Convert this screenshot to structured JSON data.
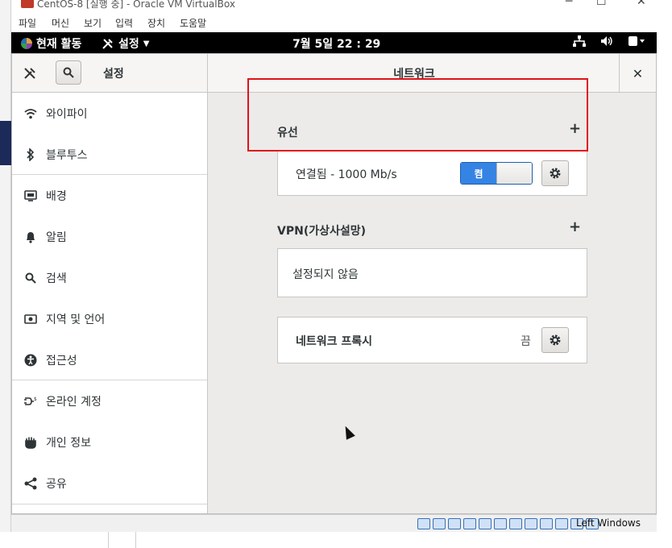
{
  "vbox": {
    "title": "CentOS-8 [실행 중] - Oracle VM VirtualBox",
    "menu": [
      "파일",
      "머신",
      "보기",
      "입력",
      "장치",
      "도움말"
    ],
    "host_key": "Left Windows"
  },
  "gnome": {
    "activities": "현재 활동",
    "app_menu": "설정",
    "clock": "7월 5일  22 : 29"
  },
  "settings": {
    "header_title": "설정",
    "panel_title": "네트워크",
    "sidebar": [
      {
        "label": "와이파이",
        "icon": "wifi-icon"
      },
      {
        "label": "블루투스",
        "icon": "bluetooth-icon"
      },
      {
        "label": "배경",
        "icon": "background-icon"
      },
      {
        "label": "알림",
        "icon": "bell-icon"
      },
      {
        "label": "검색",
        "icon": "search-icon"
      },
      {
        "label": "지역 및 언어",
        "icon": "region-icon"
      },
      {
        "label": "접근성",
        "icon": "accessibility-icon"
      },
      {
        "label": "온라인 계정",
        "icon": "online-accounts-icon"
      },
      {
        "label": "개인 정보",
        "icon": "privacy-hand-icon"
      },
      {
        "label": "공유",
        "icon": "share-icon"
      }
    ],
    "wired": {
      "heading": "유선",
      "status": "연결됨 - 1000 Mb/s",
      "toggle_on_label": "켬"
    },
    "vpn": {
      "heading": "VPN(가상사설망)",
      "status": "설정되지 않음"
    },
    "proxy": {
      "label": "네트워크 프록시",
      "state": "끔"
    }
  }
}
